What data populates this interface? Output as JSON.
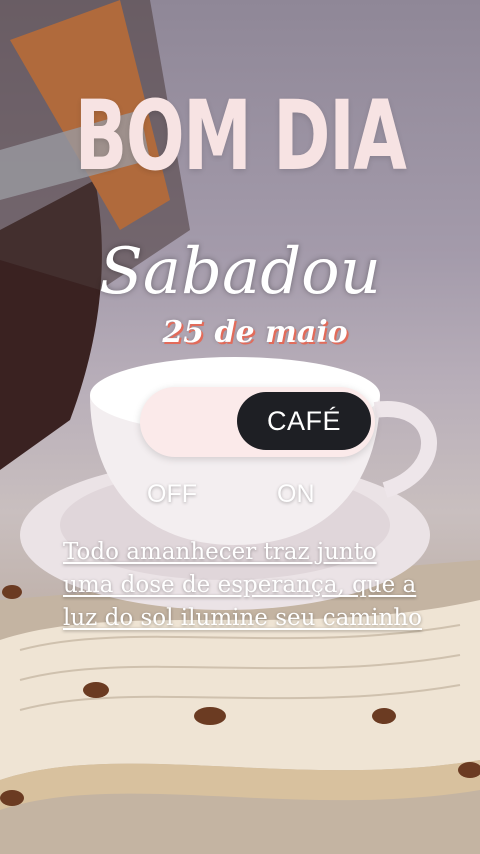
{
  "greeting": {
    "title": "BOM DIA",
    "day": "Sabadou",
    "date": "25 de maio"
  },
  "toggle": {
    "knob_label": "CAFÉ",
    "off_label": "OFF",
    "on_label": "ON",
    "state": "on"
  },
  "quote": {
    "text": "Todo amanhecer traz junto uma dose de esperança, que a luz do sol ilumine seu caminho"
  },
  "colors": {
    "title": "#f7e3e3",
    "date_shadow": "#e26b5a",
    "toggle_track": "#fbeaea",
    "toggle_knob": "#1e1f24"
  }
}
